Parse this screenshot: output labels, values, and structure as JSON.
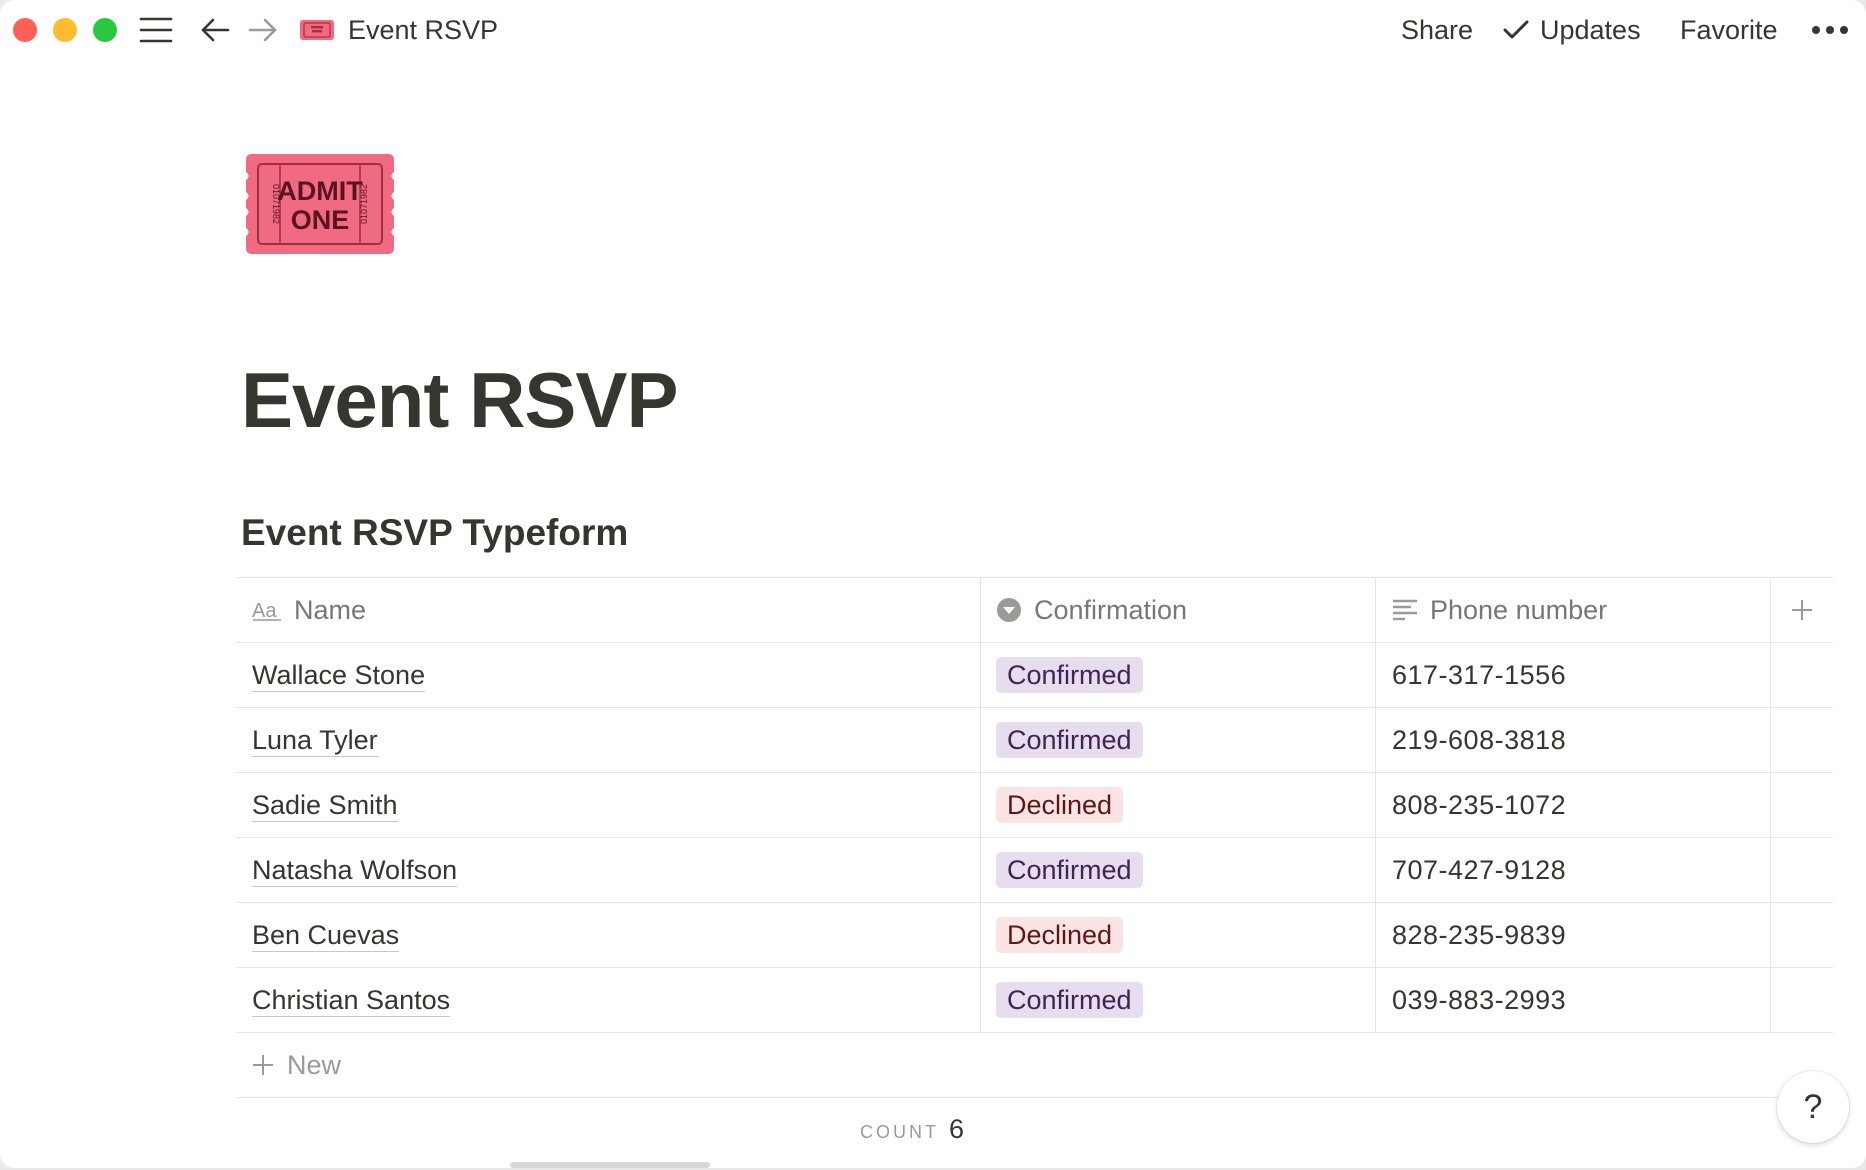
{
  "titlebar": {
    "title": "Event RSVP",
    "share_label": "Share",
    "updates_label": "Updates",
    "favorite_label": "Favorite"
  },
  "page": {
    "icon_line1": "ADMIT",
    "icon_line2": "ONE",
    "icon_serial": "01071982",
    "title": "Event RSVP",
    "database_title": "Event RSVP Typeform"
  },
  "table": {
    "columns": [
      {
        "label": "Name",
        "icon": "text-type-icon"
      },
      {
        "label": "Confirmation",
        "icon": "select-icon"
      },
      {
        "label": "Phone number",
        "icon": "text-lines-icon"
      }
    ],
    "rows": [
      {
        "name": "Wallace Stone",
        "confirmation": "Confirmed",
        "phone": "617-317-1556"
      },
      {
        "name": "Luna Tyler",
        "confirmation": "Confirmed",
        "phone": "219-608-3818"
      },
      {
        "name": "Sadie Smith",
        "confirmation": "Declined",
        "phone": "808-235-1072"
      },
      {
        "name": "Natasha Wolfson",
        "confirmation": "Confirmed",
        "phone": "707-427-9128"
      },
      {
        "name": "Ben Cuevas",
        "confirmation": "Declined",
        "phone": "828-235-9839"
      },
      {
        "name": "Christian Santos",
        "confirmation": "Confirmed",
        "phone": "039-883-2993"
      }
    ],
    "new_label": "New",
    "count_label": "COUNT",
    "count_value": "6"
  },
  "help": {
    "label": "?"
  },
  "colors": {
    "confirmed_bg": "#e6deee",
    "declined_bg": "#fbe4e4",
    "ticket": "#f06a82"
  }
}
